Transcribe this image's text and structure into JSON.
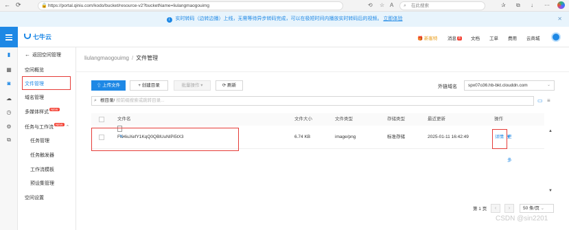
{
  "browser": {
    "url": "https://portal.qiniu.com/kodo/bucket/resource-v2?bucketName=liulangmaogouimg",
    "search_placeholder": "在此搜索"
  },
  "notice": {
    "text": "实时转码（边转边播）上线，无需等待异步转码完成，可以在极短时间内播放实时转码后的视频。",
    "link": "立即体验"
  },
  "header": {
    "logo": "七牛云",
    "new_user_offer": "新客特",
    "messages": "消息",
    "message_count": "8",
    "docs": "文档",
    "tickets": "工单",
    "billing": "费用",
    "cloud_domain": "云商城"
  },
  "sidebar": {
    "back": "返回空间管理",
    "items": [
      {
        "label": "空间概览"
      },
      {
        "label": "文件管理"
      },
      {
        "label": "域名管理"
      },
      {
        "label": "多媒体样式",
        "badge": "NEW"
      },
      {
        "label": "任务与工作流",
        "badge": "NEW"
      },
      {
        "label": "任务管理"
      },
      {
        "label": "任务触发器"
      },
      {
        "label": "工作流模板"
      },
      {
        "label": "预设集管理"
      },
      {
        "label": "空间设置"
      }
    ]
  },
  "breadcrumb": {
    "bucket": "liulangmaogouimg",
    "page": "文件管理"
  },
  "toolbar": {
    "upload": "上传文件",
    "create_dir": "创建目录",
    "batch": "批量操作",
    "refresh": "刷新",
    "domain_label": "外链域名",
    "domain_value": "spx07o36.hb-bkt.clouddn.com"
  },
  "path": {
    "root": "根目录/",
    "placeholder": "按前缀搜索或跳转目录..."
  },
  "table": {
    "headers": [
      "文件名",
      "文件大小",
      "文件类型",
      "存储类型",
      "最近更新",
      "操作"
    ],
    "rows": [
      {
        "name": "Fi94iuXefY1KqQ0QBlUuNlPi5tX3",
        "size": "6.74 KB",
        "type": "image/png",
        "storage": "标准存储",
        "updated": "2025-01-11 16:42:49",
        "op_detail": "详情",
        "op_more": "更多"
      }
    ]
  },
  "pager": {
    "page": "第 1 页",
    "page_size": "50 条/页"
  },
  "watermark": "CSDN @sin2201",
  "colors": {
    "accent": "#1e88e5",
    "highlight": "#e53935"
  }
}
